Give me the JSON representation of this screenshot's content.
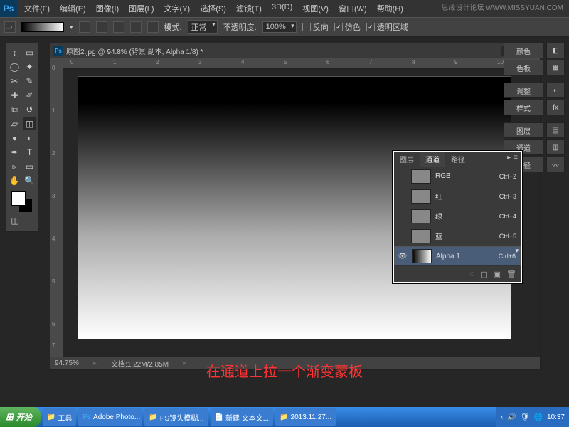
{
  "menu": {
    "file": "文件(F)",
    "edit": "编辑(E)",
    "image": "图像(I)",
    "layer": "图层(L)",
    "type": "文字(Y)",
    "select": "选择(S)",
    "filter": "滤镜(T)",
    "td": "3D(D)",
    "view": "视图(V)",
    "window": "窗口(W)",
    "help": "帮助(H)"
  },
  "watermark": "思缘设计论坛 WWW.MISSYUAN.COM",
  "options": {
    "mode_lbl": "模式:",
    "mode_val": "正常",
    "opacity_lbl": "不透明度:",
    "opacity_val": "100%",
    "reverse": "反向",
    "dither": "仿色",
    "transparency": "透明区域"
  },
  "doc": {
    "title": "原图2.jpg @ 94.8% (背景 副本, Alpha 1/8) *",
    "zoom": "94.75%",
    "filesize": "文档:1.22M/2.85M"
  },
  "right": {
    "color": "颜色",
    "swatches": "色板",
    "adjust": "调整",
    "styles": "样式",
    "layers": "图层",
    "channels": "通道",
    "paths": "路径"
  },
  "channels_panel": {
    "tabs": {
      "layers": "图层",
      "channels": "通道",
      "paths": "路径"
    },
    "rows": [
      {
        "name": "RGB",
        "shortcut": "Ctrl+2"
      },
      {
        "name": "红",
        "shortcut": "Ctrl+3"
      },
      {
        "name": "绿",
        "shortcut": "Ctrl+4"
      },
      {
        "name": "蓝",
        "shortcut": "Ctrl+5"
      },
      {
        "name": "Alpha 1",
        "shortcut": "Ctrl+6"
      }
    ]
  },
  "caption": "在通道上拉一个渐变蒙板",
  "taskbar": {
    "start": "开始",
    "items": [
      "工具",
      "Adobe Photo...",
      "PS镜头模糊...",
      "新建 文本文...",
      "2013.11.27..."
    ],
    "time": "10:37"
  }
}
